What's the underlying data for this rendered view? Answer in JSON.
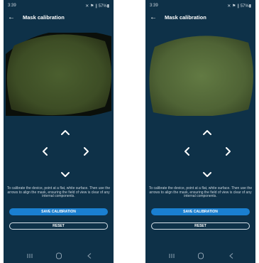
{
  "status_bar": {
    "left_time": "3:39",
    "right_time": "3:39",
    "left_icons": "✕ ⚑ ∥ 57%▮",
    "right_icons": "✕ ⚑ ∥ 57%▮"
  },
  "app_bar": {
    "back_glyph": "←",
    "title": "Mask calibration"
  },
  "instructions": "To calibrate the device, point at a flat, white surface. Then use the arrows to align the mask, ensuring the field of view is clear of any internal components.",
  "buttons": {
    "save": "SAVE CALIBRATION",
    "reset": "RESET"
  },
  "colors": {
    "background": "#0e3148",
    "accent": "#1a7fd0",
    "camera_left": "#3d4d25",
    "camera_right": "#4f6335"
  },
  "icons": {
    "back": "arrow-left-icon",
    "up": "chevron-up-icon",
    "left": "chevron-left-icon",
    "right": "chevron-right-icon",
    "down": "chevron-down-icon",
    "nav_recents": "recents-icon",
    "nav_home": "home-icon",
    "nav_back": "back-icon"
  }
}
